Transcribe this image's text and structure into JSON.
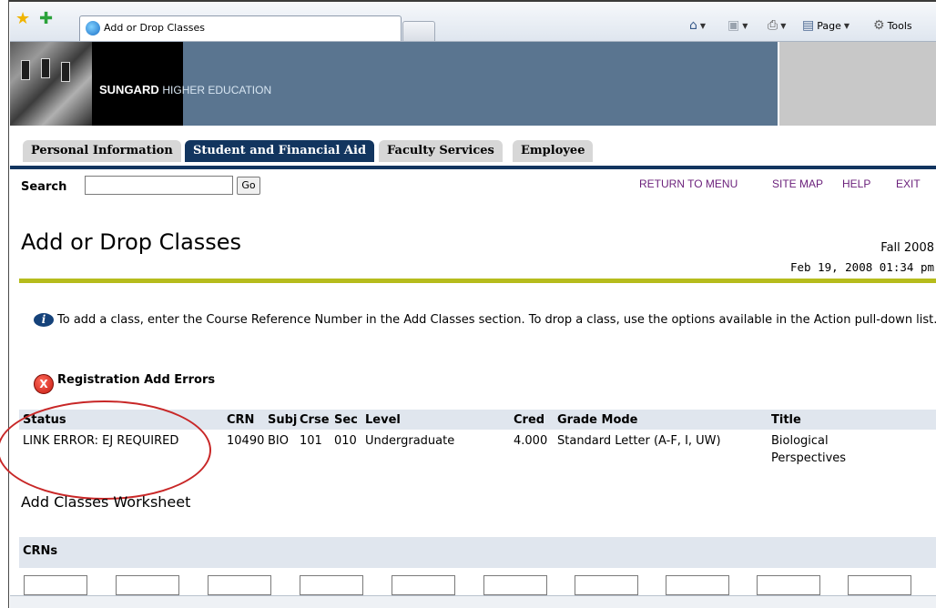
{
  "browser": {
    "tab_title": "Add or Drop Classes",
    "tools": {
      "home": "",
      "feeds": "",
      "print": "",
      "page": "Page",
      "tools": "Tools"
    }
  },
  "banner": {
    "brand_bold": "SUNGARD",
    "brand_rest": "HIGHER EDUCATION"
  },
  "nav": {
    "tabs": [
      {
        "label": "Personal Information",
        "active": false
      },
      {
        "label": "Student and Financial Aid",
        "active": true
      },
      {
        "label": "Faculty Services",
        "active": false
      },
      {
        "label": "Employee",
        "active": false
      }
    ]
  },
  "search": {
    "label": "Search",
    "value": "",
    "go_label": "Go"
  },
  "toplinks": {
    "return": "RETURN TO MENU",
    "sitemap": "SITE MAP",
    "help": "HELP",
    "exit": "EXIT"
  },
  "page": {
    "title": "Add or Drop Classes",
    "term": "Fall 2008",
    "datetime": "Feb 19, 2008 01:34 pm"
  },
  "info": {
    "text": "To add a class, enter the Course Reference Number in the Add Classes section. To drop a class, use the options available in the Action pull-down list."
  },
  "errors": {
    "title": "Registration Add Errors",
    "columns": [
      "Status",
      "CRN",
      "Subj",
      "Crse",
      "Sec",
      "Level",
      "Cred",
      "Grade Mode",
      "Title"
    ],
    "rows": [
      {
        "status": "LINK ERROR: EJ REQUIRED",
        "crn": "10490",
        "subj": "BIO",
        "crse": "101",
        "sec": "010",
        "level": "Undergraduate",
        "cred": "4.000",
        "grade_mode": "Standard Letter (A-F, I, UW)",
        "title": "Biological Perspectives"
      }
    ]
  },
  "worksheet": {
    "title": "Add Classes Worksheet",
    "crn_label": "CRNs",
    "crn_values": [
      "",
      "",
      "",
      "",
      "",
      "",
      "",
      "",
      "",
      ""
    ]
  },
  "colors": {
    "nav_active": "#12355f",
    "rule": "#b6bc1c",
    "link": "#6a1f7a",
    "highlight": "#c82727"
  }
}
